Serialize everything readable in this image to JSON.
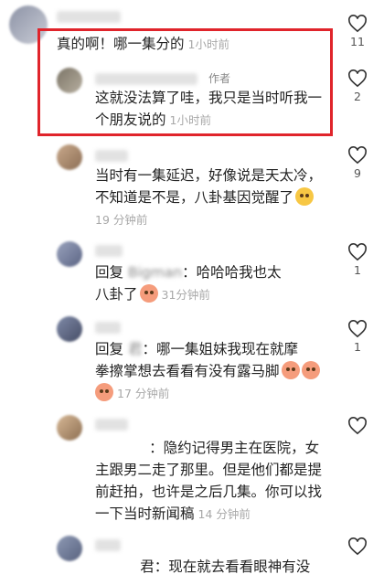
{
  "comments": [
    {
      "text": "真的啊！哪一集分的",
      "time": "1小时前",
      "likes": "11"
    },
    {
      "author_tag": "作者",
      "text1": "这就没法算了哇，我只是当时听我一",
      "text2": "个朋友说的",
      "time": "1小时前",
      "likes": "2"
    },
    {
      "line1": "当时有一集延迟，好像说是天太冷，",
      "line2": "不知道是不是，八卦基因觉醒了",
      "time": "19 分钟前",
      "likes": "9"
    },
    {
      "reply_prefix": "回复",
      "reply_to": "Bigman",
      "line1": "：哈哈哈我也太",
      "line2": "八卦了",
      "time": "31分钟前",
      "likes": "1"
    },
    {
      "reply_prefix": "回复",
      "reply_to": "君",
      "line1": "：哪一集姐妹我现在就摩",
      "line2": "拳擦掌想去看看有没有露马脚",
      "time": "17 分钟前",
      "likes": "1"
    },
    {
      "line1": "：隐约记得男主在医院，女",
      "line2": "主跟男二走了那里。但是他们都是提",
      "line3": "前赶拍，也许是之后几集。你可以找",
      "line4": "一下当时新闻稿",
      "time": "14 分钟前",
      "likes": ""
    },
    {
      "line1": "君：现在就去看看眼神有没",
      "likes": ""
    }
  ],
  "colors": {
    "highlight": "#e0242b",
    "time": "#a8a8a8"
  },
  "icons": [
    "heart-icon"
  ]
}
